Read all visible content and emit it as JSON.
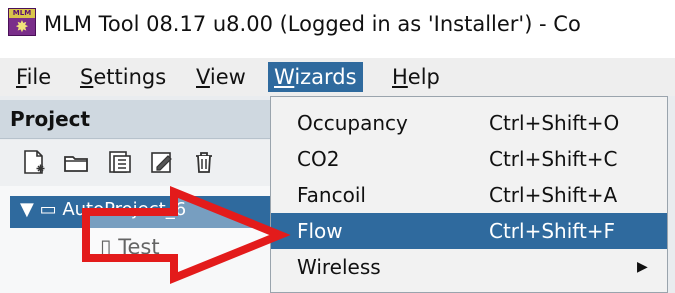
{
  "window": {
    "icon_label": "MLM",
    "title": "MLM Tool 08.17 u8.00 (Logged in as 'Installer')  -  Co"
  },
  "menubar": {
    "items": [
      {
        "label_prefix": "",
        "label_underlined": "F",
        "label_rest": "ile"
      },
      {
        "label_prefix": "",
        "label_underlined": "S",
        "label_rest": "ettings"
      },
      {
        "label_prefix": "",
        "label_underlined": "V",
        "label_rest": "iew"
      },
      {
        "label_prefix": "",
        "label_underlined": "W",
        "label_rest": "izards"
      },
      {
        "label_prefix": "",
        "label_underlined": "H",
        "label_rest": "elp"
      }
    ]
  },
  "project_panel": {
    "title": "Project",
    "tree_root": "AutoProject_6",
    "tree_child": "Test"
  },
  "wizards_menu": {
    "items": [
      {
        "label": "Occupancy",
        "accelerator": "Ctrl+Shift+O",
        "selected": false,
        "submenu": false
      },
      {
        "label": "CO2",
        "accelerator": "Ctrl+Shift+C",
        "selected": false,
        "submenu": false
      },
      {
        "label": "Fancoil",
        "accelerator": "Ctrl+Shift+A",
        "selected": false,
        "submenu": false
      },
      {
        "label": "Flow",
        "accelerator": "Ctrl+Shift+F",
        "selected": true,
        "submenu": false
      },
      {
        "label": "Wireless",
        "accelerator": "",
        "selected": false,
        "submenu": true
      }
    ],
    "submenu_arrow": "▶"
  },
  "colors": {
    "selection": "#2f6a9e",
    "menubar_bg": "#eeeeee",
    "annotation_arrow": "#e31b1b"
  }
}
